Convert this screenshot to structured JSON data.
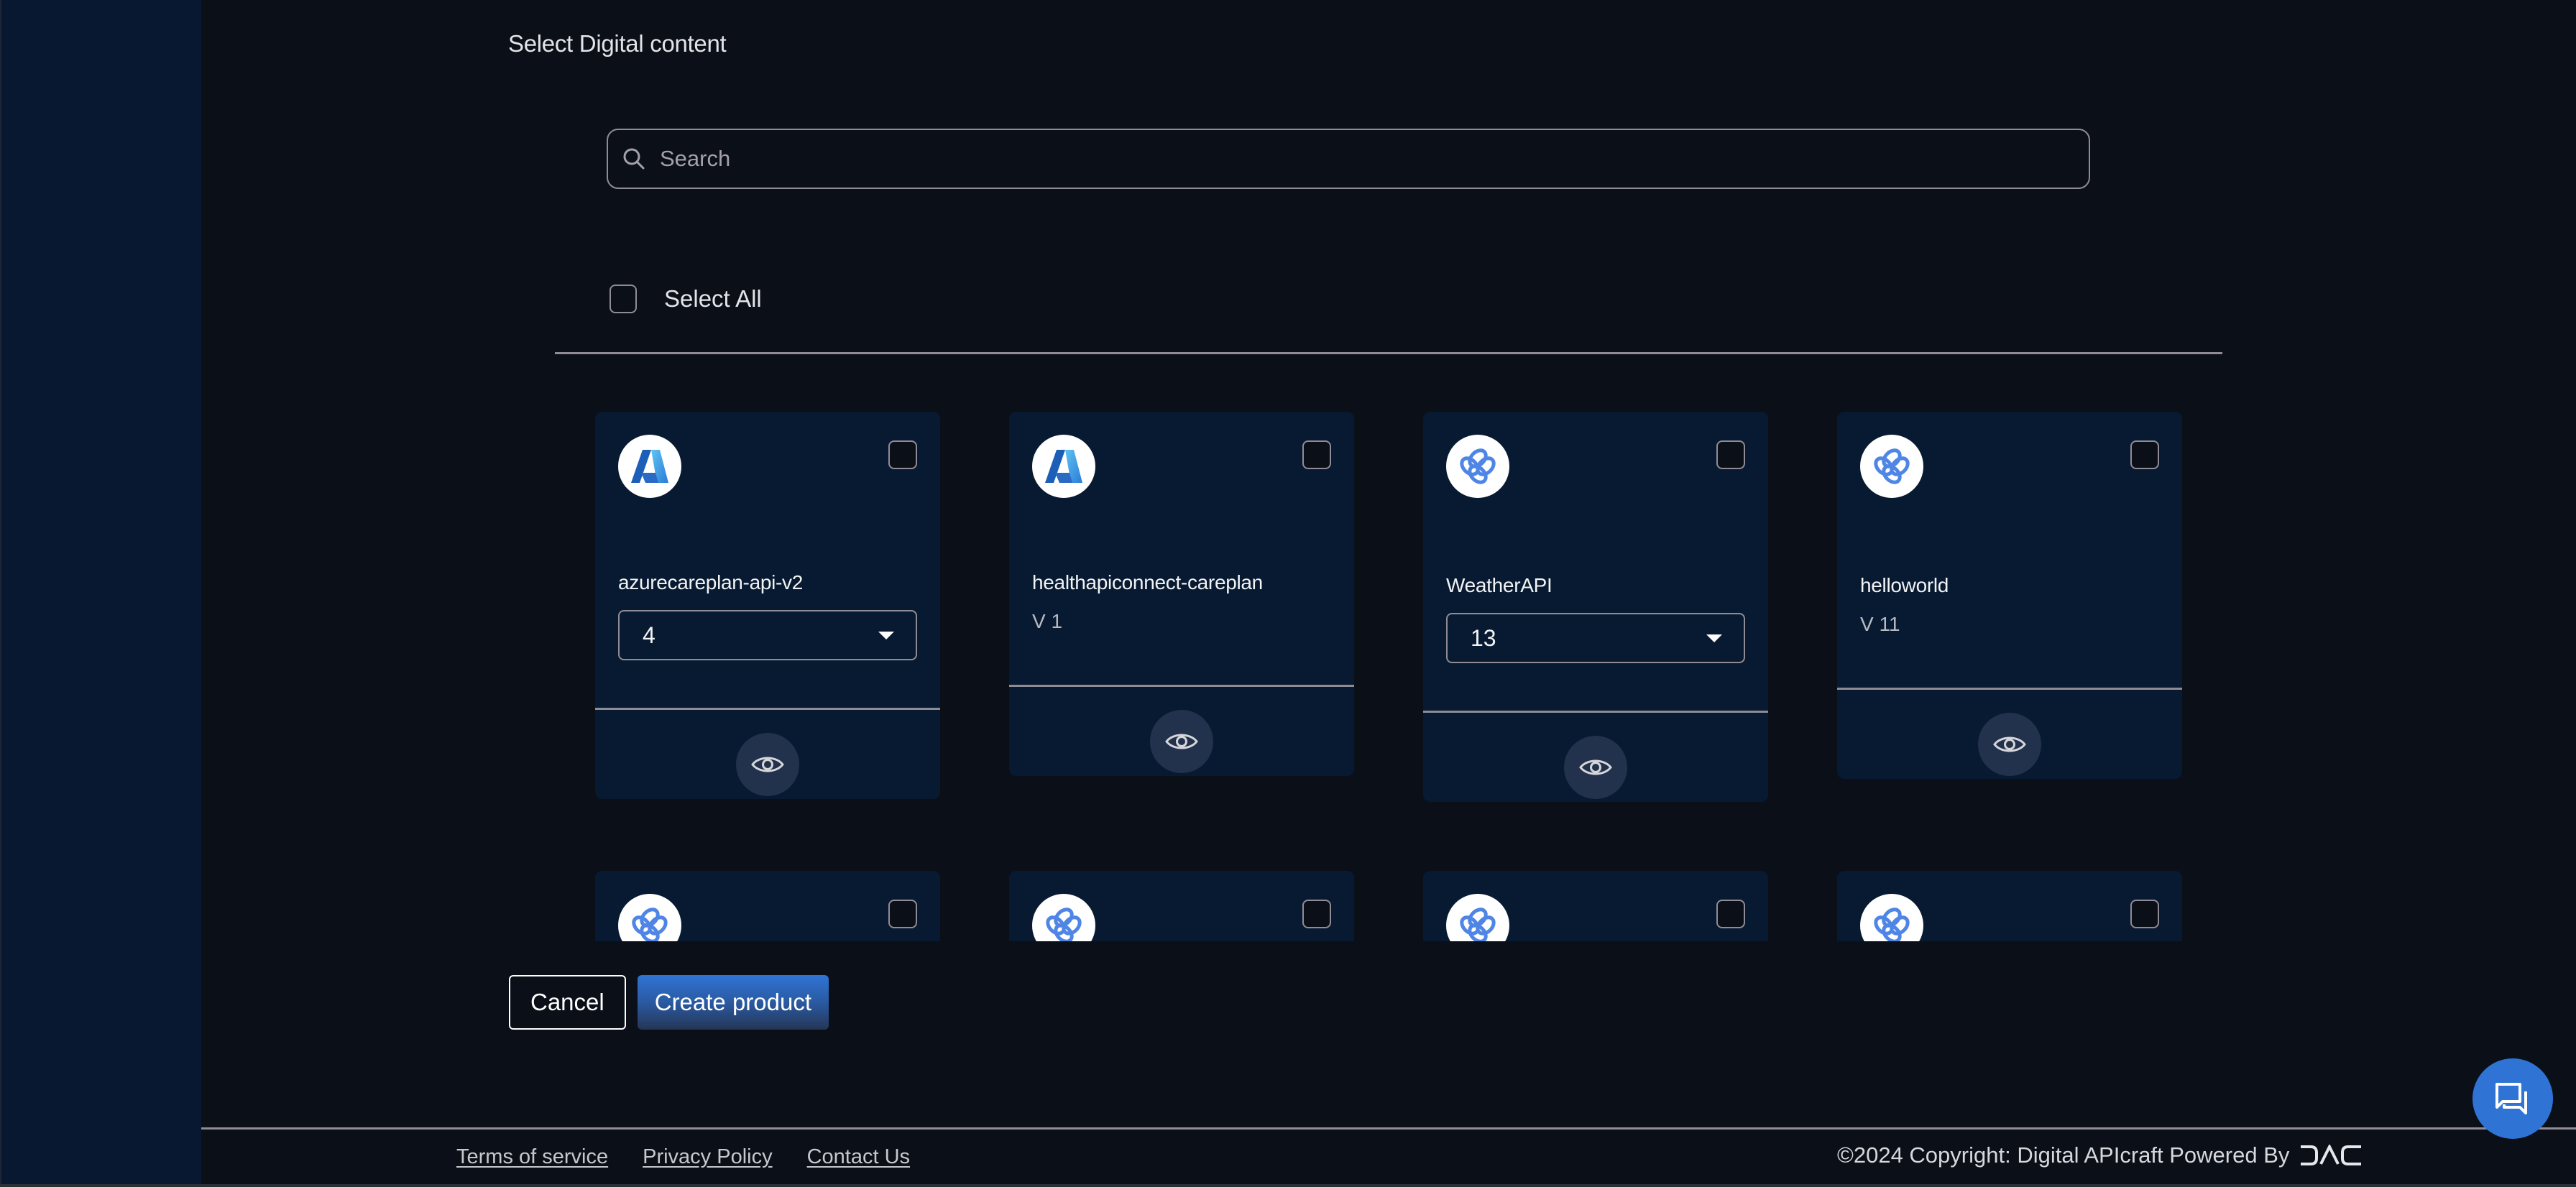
{
  "page": {
    "title": "Select Digital content"
  },
  "search": {
    "placeholder": "Search",
    "value": "",
    "icon": "search-icon"
  },
  "select_all": {
    "label": "Select All",
    "checked": false
  },
  "cards": [
    {
      "name": "azurecareplan-api-v2",
      "logo": "azure-logo-icon",
      "version_type": "dropdown",
      "version_value": "4",
      "checked": false,
      "action_icon": "eye-icon"
    },
    {
      "name": "healthapiconnect-careplan",
      "logo": "azure-logo-icon",
      "version_type": "text",
      "version_value": "V 1",
      "checked": false,
      "action_icon": "eye-icon"
    },
    {
      "name": "WeatherAPI",
      "logo": "api-gateway-logo-icon",
      "version_type": "dropdown",
      "version_value": "13",
      "checked": false,
      "action_icon": "eye-icon"
    },
    {
      "name": "helloworld",
      "logo": "api-gateway-logo-icon",
      "version_type": "text",
      "version_value": "V 11",
      "checked": false,
      "action_icon": "eye-icon"
    },
    {
      "logo": "api-gateway-logo-icon",
      "checked": false
    },
    {
      "logo": "api-gateway-logo-icon",
      "checked": false
    },
    {
      "logo": "api-gateway-logo-icon",
      "checked": false
    },
    {
      "logo": "api-gateway-logo-icon",
      "checked": false
    }
  ],
  "actions": {
    "cancel_label": "Cancel",
    "create_label": "Create product"
  },
  "footer": {
    "links": [
      "Terms of service",
      "Privacy Policy",
      "Contact Us"
    ],
    "copyright": "©2024 Copyright: Digital APIcraft Powered By",
    "brand_logo": "DAC"
  },
  "chat": {
    "icon": "chat-icon"
  },
  "colors": {
    "sidebar_bg": "#081830",
    "page_bg": "#0a0f18",
    "card_bg": "#081a31",
    "accent": "#2f74d5",
    "border": "#8f8c96"
  }
}
